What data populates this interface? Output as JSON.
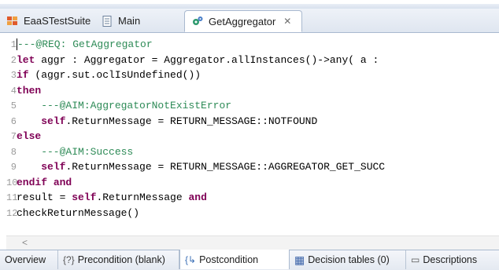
{
  "tabs": [
    {
      "label": "EaaSTestSuite",
      "icon": "suite-icon"
    },
    {
      "label": "Main",
      "icon": "document-icon"
    },
    {
      "label": "GetAggregator",
      "icon": "gear-icon",
      "close": "✕"
    }
  ],
  "code_lines": [
    {
      "n": "1",
      "parts": [
        {
          "t": "---@REQ: GetAggregator",
          "c": "cm"
        }
      ]
    },
    {
      "n": "2",
      "parts": [
        {
          "t": "let",
          "c": "kw"
        },
        {
          "t": " aggr : Aggregator = Aggregator.allInstances()->any( a : ",
          "c": "code"
        }
      ]
    },
    {
      "n": "3",
      "parts": [
        {
          "t": "if",
          "c": "kw"
        },
        {
          "t": " (aggr.sut.oclIsUndefined())",
          "c": "code"
        }
      ]
    },
    {
      "n": "4",
      "parts": [
        {
          "t": "then",
          "c": "kw"
        }
      ]
    },
    {
      "n": "5",
      "parts": [
        {
          "t": "    ---@AIM:AggregatorNotExistError",
          "c": "cm"
        }
      ]
    },
    {
      "n": "6",
      "parts": [
        {
          "t": "    ",
          "c": "code"
        },
        {
          "t": "self",
          "c": "self"
        },
        {
          "t": ".ReturnMessage = RETURN_MESSAGE::NOTFOUND",
          "c": "code"
        }
      ]
    },
    {
      "n": "7",
      "parts": [
        {
          "t": "else",
          "c": "kw"
        }
      ]
    },
    {
      "n": "8",
      "parts": [
        {
          "t": "    ---@AIM:Success",
          "c": "cm"
        }
      ]
    },
    {
      "n": "9",
      "parts": [
        {
          "t": "    ",
          "c": "code"
        },
        {
          "t": "self",
          "c": "self"
        },
        {
          "t": ".ReturnMessage = RETURN_MESSAGE::AGGREGATOR_GET_SUCC",
          "c": "code"
        }
      ]
    },
    {
      "n": "10",
      "parts": [
        {
          "t": "endif",
          "c": "kw"
        },
        {
          "t": " ",
          "c": "code"
        },
        {
          "t": "and",
          "c": "kw"
        }
      ]
    },
    {
      "n": "11",
      "parts": [
        {
          "t": "result = ",
          "c": "code"
        },
        {
          "t": "self",
          "c": "self"
        },
        {
          "t": ".ReturnMessage ",
          "c": "code"
        },
        {
          "t": "and",
          "c": "kw"
        }
      ]
    },
    {
      "n": "12",
      "parts": [
        {
          "t": "checkReturnMessage()",
          "c": "code"
        }
      ]
    }
  ],
  "scroll_arrow": "<",
  "bottom_tabs": [
    {
      "label": "Overview",
      "icon": ""
    },
    {
      "label": "Precondition (blank)",
      "icon": "{?}"
    },
    {
      "label": "Postcondition",
      "icon": "{↳"
    },
    {
      "label": "Decision tables (0)",
      "icon": "▦"
    },
    {
      "label": "Descriptions",
      "icon": "▭"
    }
  ]
}
